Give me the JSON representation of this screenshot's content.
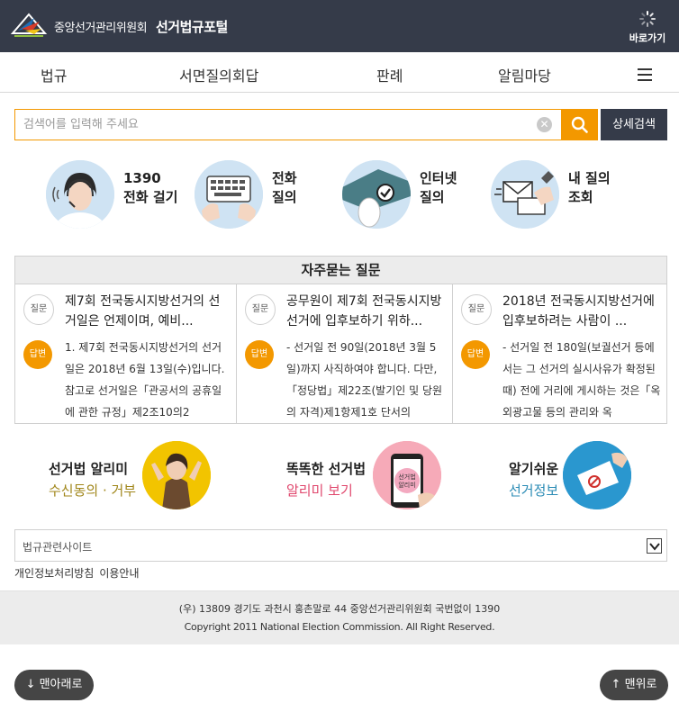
{
  "header": {
    "org_name": "중앙선거관리위원회",
    "portal_name": "선거법규포털",
    "shortcut_label": "바로가기"
  },
  "nav": {
    "items": [
      "법규",
      "서면질의회답",
      "판례",
      "알림마당"
    ]
  },
  "search": {
    "placeholder": "검색어를 입력해 주세요",
    "advanced_label": "상세검색"
  },
  "quick_services": [
    {
      "line1": "1390",
      "line2": "전화 걸기"
    },
    {
      "line1": "전화",
      "line2": "질의"
    },
    {
      "line1": "인터넷",
      "line2": "질의"
    },
    {
      "line1": "내 질의",
      "line2": "조회"
    }
  ],
  "faq": {
    "title": "자주묻는 질문",
    "question_badge": "질문",
    "answer_badge": "답변",
    "items": [
      {
        "question": "제7회 전국동시지방선거의 선거일은 언제이며, 예비...",
        "answer": "1. 제7회 전국동시지방선거의 선거일은 2018년 6월 13일(수)입니다. 참고로 선거일은「관공서의 공휴일에 관한 규정」제2조10의2"
      },
      {
        "question": "공무원이 제7회 전국동시지방선거에 입후보하기 위하...",
        "answer": "- 선거일 전 90일(2018년 3월 5일)까지 사직하여야 합니다. 다만,「정당법」제22조(발기인 및 당원의 자격)제1항제1호 단서의"
      },
      {
        "question": "2018년 전국동시지방선거에 입후보하려는 사람이 ...",
        "answer": "- 선거일 전 180일(보궐선거 등에서는 그 선거의 실시사유가 확정된 때) 전에 거리에 게시하는 것은「옥외광고물 등의 관리와 옥"
      }
    ]
  },
  "promos": [
    {
      "title": "선거법 알리미",
      "subtitle": "수신동의 · 거부",
      "subtitle_color": "#a0861a"
    },
    {
      "title": "똑똑한 선거법",
      "subtitle": "알리미 보기",
      "subtitle_color": "#e0466c"
    },
    {
      "title": "알기쉬운",
      "subtitle": "선거정보",
      "subtitle_color": "#2a8bb5"
    }
  ],
  "related": {
    "label": "법규관련사이트"
  },
  "policy": {
    "privacy": "개인정보처리방침",
    "usage": "이용안내"
  },
  "footer": {
    "address": "(우) 13809 경기도 과천시 홍촌말로 44 중앙선거관리위원회 국번없이 1390",
    "copyright": "Copyright 2011 National Election Commission. All Right Reserved."
  },
  "floating": {
    "to_bottom": "↓ 맨아래로",
    "to_top": "↑ 맨위로"
  },
  "colors": {
    "header_bg": "#353b49",
    "accent": "#f39800"
  }
}
